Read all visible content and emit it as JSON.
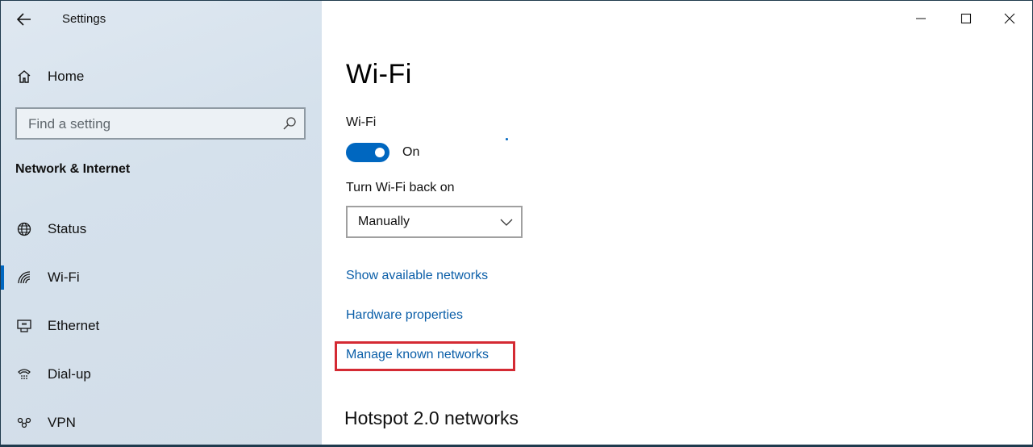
{
  "window": {
    "app_title": "Settings",
    "controls": {
      "minimize": "minimize",
      "maximize": "maximize",
      "close": "close"
    }
  },
  "sidebar": {
    "home_label": "Home",
    "search": {
      "placeholder": "Find a setting"
    },
    "section_title": "Network & Internet",
    "items": [
      {
        "label": "Status",
        "icon": "globe-icon",
        "selected": false
      },
      {
        "label": "Wi-Fi",
        "icon": "wifi-icon",
        "selected": true
      },
      {
        "label": "Ethernet",
        "icon": "ethernet-icon",
        "selected": false
      },
      {
        "label": "Dial-up",
        "icon": "dialup-icon",
        "selected": false
      },
      {
        "label": "VPN",
        "icon": "vpn-icon",
        "selected": false
      }
    ]
  },
  "main": {
    "page_title": "Wi-Fi",
    "wifi_toggle": {
      "label": "Wi-Fi",
      "state": "On",
      "on": true
    },
    "turn_back_on": {
      "label": "Turn Wi-Fi back on",
      "value": "Manually"
    },
    "links": {
      "show_available": "Show available networks",
      "hardware_properties": "Hardware properties",
      "manage_known": "Manage known networks"
    },
    "hotspot_heading": "Hotspot 2.0 networks"
  },
  "colors": {
    "accent": "#0067c0",
    "link": "#0a5ea8",
    "highlight_border": "#d42a33",
    "sidebar_bg": "#d8e3ed"
  }
}
